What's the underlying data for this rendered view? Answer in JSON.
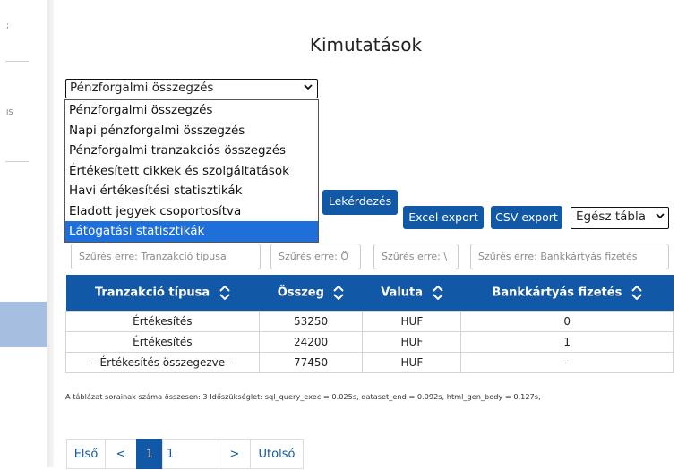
{
  "page": {
    "title": "Kimutatások"
  },
  "report_select": {
    "value": "Pénzforgalmi összegzés",
    "options": [
      "Pénzforgalmi összegzés",
      "Napi pénzforgalmi összegzés",
      "Pénzforgalmi tranzakciós összegzés",
      "Értékesített cikkek és szolgáltatások",
      "Havi értékesítési statisztikák",
      "Eladott jegyek csoportosítva",
      "Látogatási statisztikák"
    ],
    "highlighted_option": "Látogatási statisztikák"
  },
  "toolbar": {
    "query_label": "Lekérdezés",
    "excel_label": "Excel export",
    "csv_label": "CSV export",
    "rows_select_value": "Egész tábla"
  },
  "filters": [
    "Szűrés erre: Tranzakció típusa",
    "Szűrés erre: Ö",
    "Szűrés erre: \\",
    "Szűrés erre: Bankkártyás fizetés"
  ],
  "table": {
    "headers": [
      "Tranzakció típusa",
      "Összeg",
      "Valuta",
      "Bankkártyás fizetés"
    ],
    "rows": [
      [
        "Értékesítés",
        "53250",
        "HUF",
        "0"
      ],
      [
        "Értékesítés",
        "24200",
        "HUF",
        "1"
      ],
      [
        "-- Értékesítés összegezve --",
        "77450",
        "HUF",
        "-"
      ]
    ]
  },
  "stats_text": "A táblázat sorainak száma összesen: 3   Időszükséglet: sql_query_exec = 0.025s, dataset_end = 0.092s, html_gen_body = 0.127s,",
  "pagination": {
    "first": "Első",
    "prev": "<",
    "current": "1",
    "page_input": "1",
    "next": ">",
    "last": "Utolsó"
  },
  "sidebar": {
    "glyph_top": ";",
    "glyph_mid": "IS"
  },
  "colors": {
    "primary": "#1158a7",
    "highlight": "#1e6fd9",
    "sidebar_active": "#a6bfe0"
  }
}
